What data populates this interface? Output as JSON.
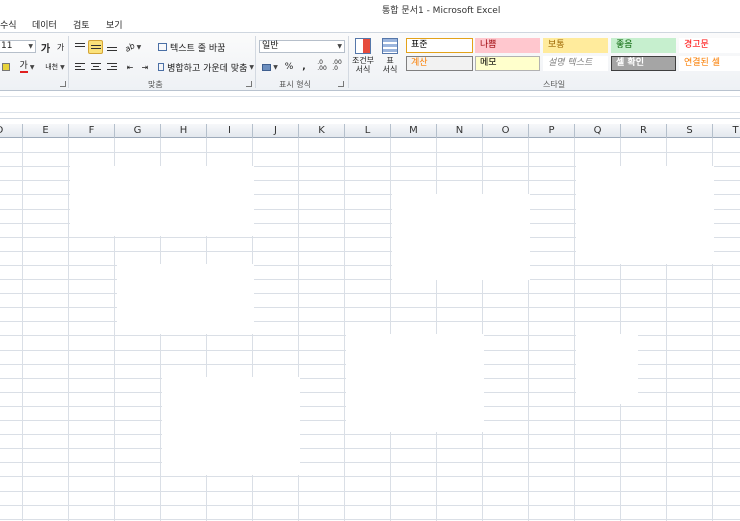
{
  "window": {
    "title": "통합 문서1 - Microsoft Excel"
  },
  "menu": {
    "items": [
      "수식",
      "데이터",
      "검토",
      "보기"
    ]
  },
  "ribbon": {
    "font": {
      "size_value": "11",
      "grow_icon": "가",
      "shrink_icon": "가",
      "font_color_icon": "가",
      "phonetic_icon": "내천"
    },
    "alignment": {
      "label": "맞춤",
      "wrap_text": "텍스트 줄 바꿈",
      "merge_center": "병합하고 가운데 맞춤",
      "orientation_icon": "ab"
    },
    "number": {
      "label": "표시 형식",
      "format_value": "일반",
      "percent": "%",
      "comma": ",",
      "increase_decimal": ".0\n.00",
      "decrease_decimal": ".00\n.0"
    },
    "styles": {
      "label": "스타일",
      "conditional_format_line1": "조건부",
      "conditional_format_line2": "서식",
      "table_format_line1": "표",
      "table_format_line2": "서식",
      "cells": [
        {
          "label": "표준",
          "bg": "#ffffff",
          "fg": "#000000",
          "border": "#e3a21a"
        },
        {
          "label": "나쁨",
          "bg": "#ffc7ce",
          "fg": "#9c0006",
          "border": "#ffc7ce"
        },
        {
          "label": "보통",
          "bg": "#ffeb9c",
          "fg": "#9c6500",
          "border": "#ffeb9c"
        },
        {
          "label": "좋음",
          "bg": "#c6efce",
          "fg": "#006100",
          "border": "#c6efce"
        },
        {
          "label": "경고문",
          "bg": "#ffffff",
          "fg": "#ff0000",
          "border": "#ffffff"
        },
        {
          "label": "계산",
          "bg": "#f2f2f2",
          "fg": "#fa7d00",
          "border": "#7f7f7f"
        },
        {
          "label": "메모",
          "bg": "#ffffcc",
          "fg": "#000000",
          "border": "#b2b2b2"
        },
        {
          "label": "설명 텍스트",
          "bg": "#ffffff",
          "fg": "#7f7f7f",
          "border": "#ffffff"
        },
        {
          "label": "셀 확인",
          "bg": "#a5a5a5",
          "fg": "#ffffff",
          "border": "#3f3f3f"
        },
        {
          "label": "연결된 셀",
          "bg": "#ffffff",
          "fg": "#fa7d00",
          "border": "#ffffff"
        }
      ]
    }
  },
  "grid": {
    "columns": [
      "D",
      "E",
      "F",
      "G",
      "H",
      "I",
      "J",
      "K",
      "L",
      "M",
      "N",
      "O",
      "P",
      "Q",
      "R",
      "S",
      "T"
    ]
  }
}
